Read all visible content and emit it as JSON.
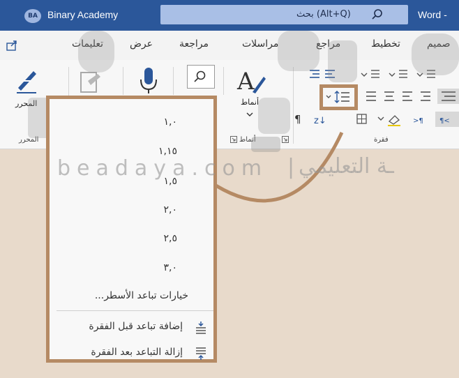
{
  "titlebar": {
    "avatar": "BA",
    "account": "Binary Academy",
    "search_label": "(Alt+Q) بحث",
    "app": "Word -"
  },
  "tabs": [
    "صميم",
    "تخطيط",
    "مراجع",
    "مراسلات",
    "مراجعة",
    "عرض",
    "تعليمات"
  ],
  "ribbon": {
    "editor_label": "المحرر",
    "editor_group_label": "المحرر",
    "styles_label": "أنماط",
    "styles_group_label": "أنماط",
    "paragraph_group_label": "فقرة"
  },
  "line_spacing_menu": {
    "options": [
      "١,٠",
      "١,١٥",
      "١,٥",
      "٢,٠",
      "٢,٥",
      "٣,٠"
    ],
    "spacing_options_link": "خيارات تباعد الأسطر...",
    "add_before": "إضافة تباعد قبل الفقرة",
    "remove_after": "إزالة التباعد بعد الفقرة"
  },
  "watermark": {
    "latin": "beadaya.com",
    "arabic": "ـة التعليمي"
  },
  "colors": {
    "title_bar": "#2b579a",
    "highlight": "#b58a64",
    "background": "#e8dacb"
  }
}
